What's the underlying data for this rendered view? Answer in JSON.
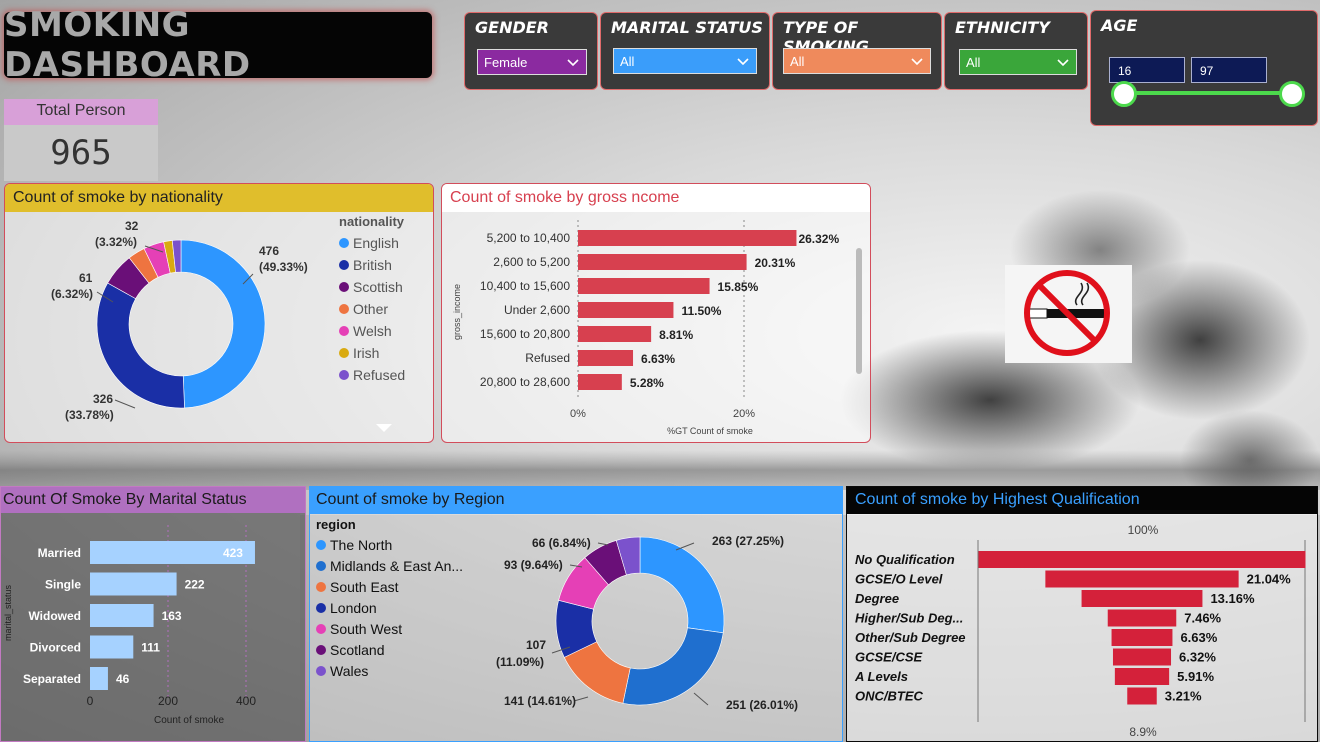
{
  "dashboard": {
    "title": "SMOKING DASHBOARD",
    "colors": {
      "accent_red": "#d7404f",
      "panel_dark": "#3a3a3a"
    }
  },
  "filters": {
    "gender": {
      "label": "GENDER",
      "value": "Female",
      "color": "#8b2aa0"
    },
    "marital": {
      "label": "MARITAL STATUS",
      "value": "All",
      "color": "#3a9dfa"
    },
    "smoking": {
      "label": "TYPE OF SMOKING",
      "value": "All",
      "color": "#ef8a5c"
    },
    "ethnicity": {
      "label": "ETHNICITY",
      "value": "All",
      "color": "#3aa63a"
    },
    "age": {
      "label": "AGE",
      "min": "16",
      "max": "97",
      "slider_color": "#4cd94c"
    }
  },
  "total_person": {
    "label": "Total Person",
    "value": "965"
  },
  "nationality_card": {
    "title": "Count of smoke by nationality",
    "legend_title": "nationality",
    "legend": [
      {
        "name": "English",
        "color": "#2d96ff"
      },
      {
        "name": "British",
        "color": "#1a2fa6"
      },
      {
        "name": "Scottish",
        "color": "#6a0f78"
      },
      {
        "name": "Other",
        "color": "#ee7440"
      },
      {
        "name": "Welsh",
        "color": "#e540b6"
      },
      {
        "name": "Irish",
        "color": "#d9aa10"
      },
      {
        "name": "Refused",
        "color": "#7b52cc"
      }
    ],
    "labels": {
      "english": "476",
      "english_pct": "(49.33%)",
      "british": "326",
      "british_pct": "(33.78%)",
      "scottish": "61",
      "scottish_pct": "(6.32%)",
      "other": "32",
      "other_pct": "(3.32%)"
    }
  },
  "income_card": {
    "title": "Count of smoke by gross ncome",
    "y_axis_label": "gross_income",
    "x_axis_label": "%GT Count of smoke",
    "x_ticks": [
      "0%",
      "20%"
    ]
  },
  "marital_card": {
    "title": "Count Of Smoke By Marital Status",
    "y_axis_label": "marital_status",
    "x_axis_label": "Count of smoke",
    "x_ticks": [
      "0",
      "200",
      "400"
    ]
  },
  "region_card": {
    "title": "Count of smoke by Region",
    "legend_title": "region",
    "legend": [
      {
        "name": "The North",
        "color": "#2d96ff"
      },
      {
        "name": "Midlands & East An...",
        "color": "#1f6fcf"
      },
      {
        "name": "South East",
        "color": "#ee7440"
      },
      {
        "name": "London",
        "color": "#1a2fa6"
      },
      {
        "name": "South West",
        "color": "#e540b6"
      },
      {
        "name": "Scotland",
        "color": "#6a0f78"
      },
      {
        "name": "Wales",
        "color": "#7b52cc"
      }
    ],
    "labels": {
      "north": "263 (27.25%)",
      "midlands": "251 (26.01%)",
      "southeast": "141 (14.61%)",
      "london": "107",
      "london_pct": "(11.09%)",
      "southwest": "93 (9.64%)",
      "scotland": "66 (6.84%)"
    }
  },
  "qual_card": {
    "title": "Count of smoke by Highest Qualification",
    "top_label": "100%",
    "bottom_label": "8.9%"
  },
  "chart_data": [
    {
      "type": "pie",
      "title": "Count of smoke by nationality",
      "categories": [
        "English",
        "British",
        "Scottish",
        "Other",
        "Welsh",
        "Irish",
        "Refused"
      ],
      "values": [
        476,
        326,
        61,
        32,
        38,
        16,
        16
      ]
    },
    {
      "type": "bar",
      "title": "Count of smoke by gross ncome",
      "categories": [
        "5,200 to 10,400",
        "2,600 to 5,200",
        "10,400 to 15,600",
        "Under 2,600",
        "15,600 to 20,800",
        "Refused",
        "20,800 to 28,600"
      ],
      "values": [
        26.32,
        20.31,
        15.85,
        11.5,
        8.81,
        6.63,
        5.28
      ],
      "value_labels": [
        "26.32%",
        "20.31%",
        "15.85%",
        "11.50%",
        "8.81%",
        "6.63%",
        "5.28%"
      ],
      "xlabel": "%GT Count of smoke",
      "ylabel": "gross_income",
      "xlim": [
        0,
        30
      ]
    },
    {
      "type": "bar",
      "title": "Count Of Smoke By Marital Status",
      "categories": [
        "Married",
        "Single",
        "Widowed",
        "Divorced",
        "Separated"
      ],
      "values": [
        423,
        222,
        163,
        111,
        46
      ],
      "xlabel": "Count of smoke",
      "ylabel": "marital_status",
      "xlim": [
        0,
        470
      ]
    },
    {
      "type": "pie",
      "title": "Count of smoke by Region",
      "categories": [
        "The North",
        "Midlands & East An...",
        "South East",
        "London",
        "South West",
        "Scotland",
        "Wales"
      ],
      "values": [
        263,
        251,
        141,
        107,
        93,
        66,
        44
      ]
    },
    {
      "type": "bar",
      "title": "Count of smoke by Highest Qualification",
      "categories": [
        "No Qualification",
        "GCSE/O Level",
        "Degree",
        "Higher/Sub Deg...",
        "Other/Sub Degree",
        "GCSE/CSE",
        "A Levels",
        "ONC/BTEC"
      ],
      "values": [
        35.6,
        21.04,
        13.16,
        7.46,
        6.63,
        6.32,
        5.91,
        3.21
      ],
      "value_labels": [
        "",
        "21.04%",
        "13.16%",
        "7.46%",
        "6.63%",
        "6.32%",
        "5.91%",
        "3.21%"
      ]
    }
  ]
}
